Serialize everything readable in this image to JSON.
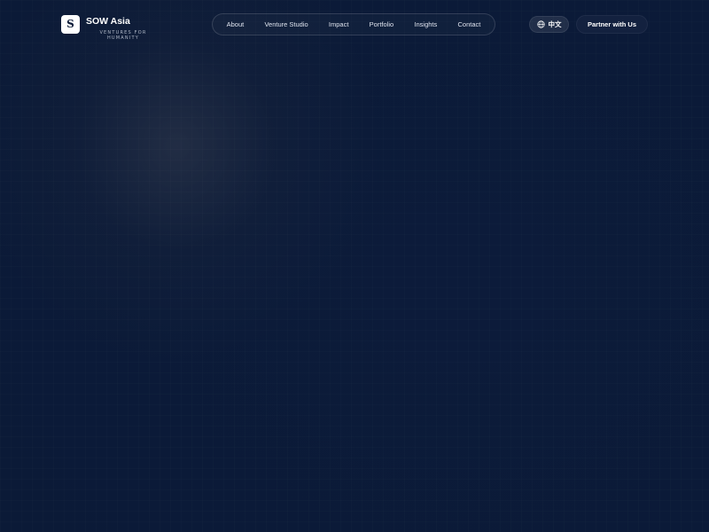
{
  "brand": {
    "logo_letter": "S",
    "name": "SOW Asia",
    "tagline": "VENTURES FOR HUMANITY"
  },
  "nav": {
    "items": [
      {
        "label": "About"
      },
      {
        "label": "Venture Studio"
      },
      {
        "label": "Impact"
      },
      {
        "label": "Portfolio"
      },
      {
        "label": "Insights"
      },
      {
        "label": "Contact"
      }
    ]
  },
  "language_toggle": {
    "icon": "globe-icon",
    "label": "中文"
  },
  "cta": {
    "label": "Partner with Us"
  },
  "colors": {
    "background": "#0b1a37",
    "text": "#ffffff",
    "nav_text": "#dfe4ee"
  }
}
